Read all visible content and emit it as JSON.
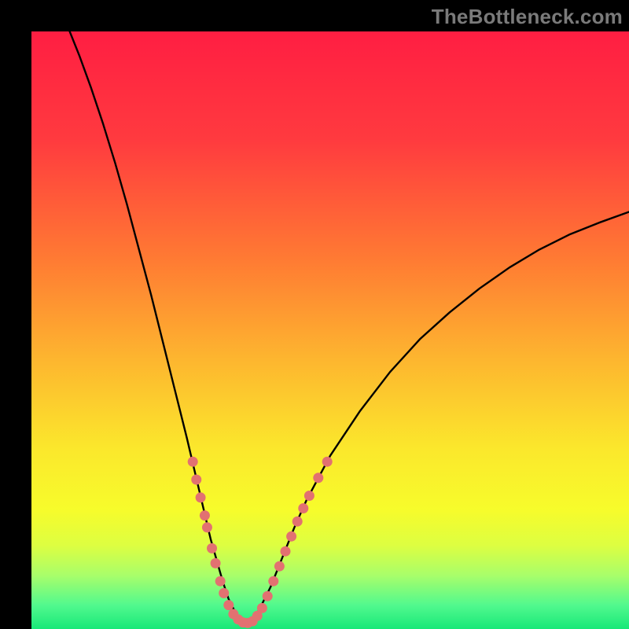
{
  "watermark": "TheBottleneck.com",
  "colors": {
    "frame": "#000000",
    "curve": "#000000",
    "dots": "#E27171",
    "gradient_stops": [
      {
        "offset": 0.0,
        "color": "#FF1E42"
      },
      {
        "offset": 0.18,
        "color": "#FF3A3F"
      },
      {
        "offset": 0.38,
        "color": "#FF7A33"
      },
      {
        "offset": 0.55,
        "color": "#FDB62F"
      },
      {
        "offset": 0.7,
        "color": "#FBE82C"
      },
      {
        "offset": 0.8,
        "color": "#F7FC2B"
      },
      {
        "offset": 0.86,
        "color": "#DDFE41"
      },
      {
        "offset": 0.91,
        "color": "#A9FE6A"
      },
      {
        "offset": 0.96,
        "color": "#52F98E"
      },
      {
        "offset": 1.0,
        "color": "#18E878"
      }
    ]
  },
  "chart_data": {
    "type": "line",
    "title": "",
    "xlabel": "",
    "ylabel": "",
    "xlim": [
      0,
      100
    ],
    "ylim": [
      0,
      100
    ],
    "series": [
      {
        "name": "bottleneck-curve",
        "x": [
          6,
          8,
          10,
          12,
          14,
          16,
          18,
          20,
          22,
          24,
          26,
          28,
          30,
          32,
          33,
          34,
          35,
          36,
          37,
          38,
          40,
          42,
          44,
          46,
          50,
          55,
          60,
          65,
          70,
          75,
          80,
          85,
          90,
          95,
          100
        ],
        "y": [
          101,
          96,
          90.5,
          84.5,
          78,
          71,
          63.5,
          56,
          48,
          40,
          32,
          23.5,
          15,
          8,
          5,
          3,
          1.5,
          1,
          1.5,
          3,
          7,
          12,
          17,
          21.5,
          29,
          36.5,
          43,
          48.5,
          53,
          57,
          60.5,
          63.5,
          66,
          68,
          69.8
        ]
      }
    ],
    "highlight_dots": {
      "name": "marked-points",
      "points": [
        {
          "x": 27.0,
          "y": 28.0
        },
        {
          "x": 27.6,
          "y": 25.0
        },
        {
          "x": 28.3,
          "y": 22.0
        },
        {
          "x": 29.0,
          "y": 19.0
        },
        {
          "x": 29.4,
          "y": 17.0
        },
        {
          "x": 30.2,
          "y": 13.5
        },
        {
          "x": 30.8,
          "y": 11.0
        },
        {
          "x": 31.6,
          "y": 8.0
        },
        {
          "x": 32.2,
          "y": 6.0
        },
        {
          "x": 33.0,
          "y": 4.0
        },
        {
          "x": 33.8,
          "y": 2.5
        },
        {
          "x": 34.6,
          "y": 1.6
        },
        {
          "x": 35.4,
          "y": 1.1
        },
        {
          "x": 36.2,
          "y": 1.0
        },
        {
          "x": 37.0,
          "y": 1.3
        },
        {
          "x": 37.8,
          "y": 2.2
        },
        {
          "x": 38.6,
          "y": 3.5
        },
        {
          "x": 39.5,
          "y": 5.5
        },
        {
          "x": 40.5,
          "y": 8.0
        },
        {
          "x": 41.5,
          "y": 10.5
        },
        {
          "x": 42.5,
          "y": 13.0
        },
        {
          "x": 43.5,
          "y": 15.5
        },
        {
          "x": 44.5,
          "y": 18.0
        },
        {
          "x": 45.5,
          "y": 20.2
        },
        {
          "x": 46.5,
          "y": 22.3
        },
        {
          "x": 48.0,
          "y": 25.3
        },
        {
          "x": 49.5,
          "y": 28.0
        }
      ]
    }
  }
}
